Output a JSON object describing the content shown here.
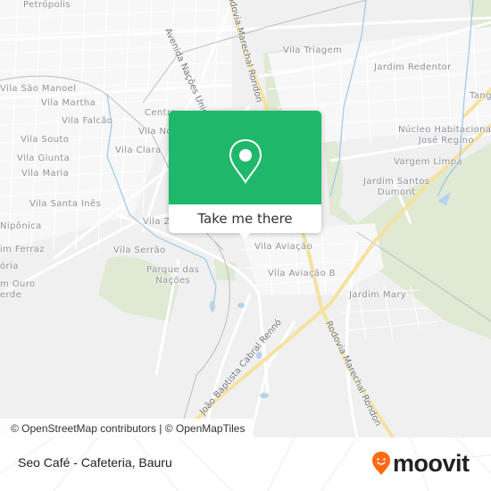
{
  "map": {
    "places": [
      {
        "label": "Petrópolis"
      },
      {
        "label": "Vila São Manoel"
      },
      {
        "label": "Vila Martha"
      },
      {
        "label": "Vila Falcão"
      },
      {
        "label": "Vila Souto"
      },
      {
        "label": "Vila Giunta"
      },
      {
        "label": "Vila Maria"
      },
      {
        "label": "Vila Santa Inês"
      },
      {
        "label": "Nipônica"
      },
      {
        "label": "im Ferraz"
      },
      {
        "label": "ória"
      },
      {
        "label": "m Ouro\nerde"
      },
      {
        "label": "Centro"
      },
      {
        "label": "Vila Nova"
      },
      {
        "label": "Vila Clara"
      },
      {
        "label": "Vila Z"
      },
      {
        "label": "Vila Serrão"
      },
      {
        "label": "Parque das\nNações"
      },
      {
        "label": "Vila Aviação"
      },
      {
        "label": "Vila Aviação B"
      },
      {
        "label": "Vila Triagem"
      },
      {
        "label": "Jardim Redentor"
      },
      {
        "label": "Tang"
      },
      {
        "label": "Núcleo Habitacional\nJosé Regino"
      },
      {
        "label": "Vargem Limpa"
      },
      {
        "label": "Jardim Santos\nDumont"
      },
      {
        "label": "Jardim Mary"
      }
    ],
    "roads": [
      {
        "label": "Avenida Nações Unidas"
      },
      {
        "label": "Rodovia Marechal Rondon"
      },
      {
        "label": "Rodovia Marechal Rondon"
      },
      {
        "label": "João Baptista Cabral Rennó"
      }
    ],
    "attribution": "© OpenStreetMap contributors | © OpenMapTiles"
  },
  "popup": {
    "icon": "map-pin-icon",
    "button_label": "Take me there",
    "color": "#1fb86b"
  },
  "footer": {
    "title": "Seo Café - Cafeteria, Bauru",
    "brand": "moovit",
    "brand_color": "#ff6a13"
  }
}
